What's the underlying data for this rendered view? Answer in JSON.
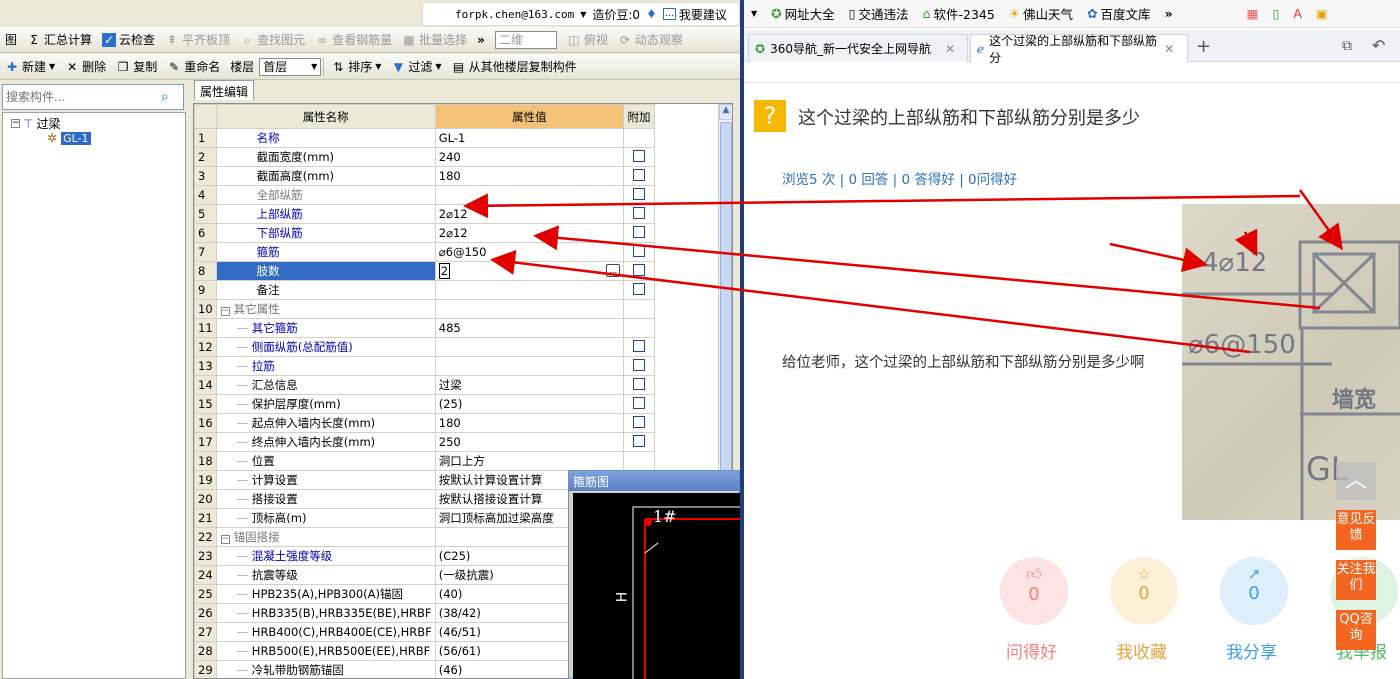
{
  "toolbar1": {
    "items": [
      {
        "label": "图"
      },
      {
        "label": "汇总计算"
      },
      {
        "label": "云检查"
      },
      {
        "label": "平齐板顶"
      },
      {
        "label": "查找图元"
      },
      {
        "label": "查看钢筋量"
      },
      {
        "label": "批量选择"
      },
      {
        "label": "二维"
      },
      {
        "label": "俯视"
      },
      {
        "label": "动态观察"
      }
    ]
  },
  "toolbar2": {
    "new": "新建",
    "delete": "删除",
    "copy": "复制",
    "rename": "重命名",
    "floor_label": "楼层",
    "floor_value": "首层",
    "sort": "排序",
    "filter": "过滤",
    "copy_from": "从其他楼层复制构件"
  },
  "search": {
    "placeholder": "搜索构件..."
  },
  "tree": {
    "root": "过梁",
    "child": "GL-1"
  },
  "prop_tab": "属性编辑",
  "grid": {
    "headers": {
      "name": "属性名称",
      "value": "属性值",
      "extra": "附加"
    },
    "rows": [
      {
        "n": "1",
        "name": "名称",
        "value": "GL-1",
        "style": "blue",
        "cb": false
      },
      {
        "n": "2",
        "name": "截面宽度(mm)",
        "value": "240",
        "style": "",
        "cb": true
      },
      {
        "n": "3",
        "name": "截面高度(mm)",
        "value": "180",
        "style": "",
        "cb": true
      },
      {
        "n": "4",
        "name": "全部纵筋",
        "value": "",
        "style": "grey",
        "cb": true
      },
      {
        "n": "5",
        "name": "上部纵筋",
        "value": "2⌀12",
        "style": "blue",
        "cb": true
      },
      {
        "n": "6",
        "name": "下部纵筋",
        "value": "2⌀12",
        "style": "blue",
        "cb": true
      },
      {
        "n": "7",
        "name": "箍筋",
        "value": "⌀6@150",
        "style": "blue",
        "cb": true
      },
      {
        "n": "8",
        "name": "肢数",
        "value": "2",
        "style": "sel",
        "cb": true
      },
      {
        "n": "9",
        "name": "备注",
        "value": "",
        "style": "",
        "cb": true
      },
      {
        "n": "10",
        "name": "其它属性",
        "value": "",
        "style": "group",
        "cb": false
      },
      {
        "n": "11",
        "name": "其它箍筋",
        "value": "485",
        "style": "blue",
        "cb": false
      },
      {
        "n": "12",
        "name": "侧面纵筋(总配筋值)",
        "value": "",
        "style": "blue",
        "cb": true
      },
      {
        "n": "13",
        "name": "拉筋",
        "value": "",
        "style": "blue",
        "cb": true
      },
      {
        "n": "14",
        "name": "汇总信息",
        "value": "过梁",
        "style": "",
        "cb": true
      },
      {
        "n": "15",
        "name": "保护层厚度(mm)",
        "value": "(25)",
        "style": "",
        "cb": true
      },
      {
        "n": "16",
        "name": "起点伸入墙内长度(mm)",
        "value": "180",
        "style": "",
        "cb": true
      },
      {
        "n": "17",
        "name": "终点伸入墙内长度(mm)",
        "value": "250",
        "style": "",
        "cb": true
      },
      {
        "n": "18",
        "name": "位置",
        "value": "洞口上方",
        "style": "",
        "cb": false
      },
      {
        "n": "19",
        "name": "计算设置",
        "value": "按默认计算设置计算",
        "style": "",
        "cb": false
      },
      {
        "n": "20",
        "name": "搭接设置",
        "value": "按默认搭接设置计算",
        "style": "",
        "cb": false
      },
      {
        "n": "21",
        "name": "顶标高(m)",
        "value": "洞口顶标高加过梁高度",
        "style": "",
        "cb": false
      },
      {
        "n": "22",
        "name": "锚固搭接",
        "value": "",
        "style": "group",
        "cb": false
      },
      {
        "n": "23",
        "name": "混凝土强度等级",
        "value": "(C25)",
        "style": "blue",
        "cb": false
      },
      {
        "n": "24",
        "name": "抗震等级",
        "value": "(一级抗震)",
        "style": "",
        "cb": false
      },
      {
        "n": "25",
        "name": "HPB235(A),HPB300(A)锚固",
        "value": "(40)",
        "style": "",
        "cb": false
      },
      {
        "n": "26",
        "name": "HRB335(B),HRB335E(BE),HRBF",
        "value": "(38/42)",
        "style": "",
        "cb": false
      },
      {
        "n": "27",
        "name": "HRB400(C),HRB400E(CE),HRBF",
        "value": "(46/51)",
        "style": "",
        "cb": false
      },
      {
        "n": "28",
        "name": "HRB500(E),HRB500E(EE),HRBF",
        "value": "(56/61)",
        "style": "",
        "cb": false
      },
      {
        "n": "29",
        "name": "冷轧带肋钢筋锚固",
        "value": "(46)",
        "style": "",
        "cb": false
      }
    ]
  },
  "stirrup": {
    "title": "箍筋图",
    "label_1": "1#",
    "label_h": "H"
  },
  "topbar": {
    "email": "forpk.chen@163.com",
    "balance": "造价豆:0",
    "suggest": "我要建议"
  },
  "bookmarks": [
    "网址大全",
    "交通违法",
    "软件-2345",
    "佛山天气",
    "百度文库"
  ],
  "tabs": [
    {
      "label": "360导航_新一代安全上网导航"
    },
    {
      "label": "这个过梁的上部纵筋和下部纵筋分"
    }
  ],
  "question": {
    "title": "这个过梁的上部纵筋和下部纵筋分别是多少",
    "stats": "浏览5 次 | 0 回答 | 0 答得好 | 0问得好",
    "body": "给位老师，这个过梁的上部纵筋和下部纵筋分别是多少啊"
  },
  "photo": {
    "top_label": "4⌀12",
    "bottom_label": "⌀6@150",
    "wall_label": "墙宽",
    "gl_label": "GL"
  },
  "actions": [
    {
      "count": "0",
      "label": "问得好",
      "color": "#f47f7f",
      "bg": "#fde3e3"
    },
    {
      "count": "0",
      "label": "我收藏",
      "color": "#e8a23c",
      "bg": "#fdf0d9"
    },
    {
      "count": "0",
      "label": "我分享",
      "color": "#3da0e4",
      "bg": "#ddeffb"
    },
    {
      "count": "",
      "label": "我举报",
      "color": "#56b86a",
      "bg": "#dff3e3"
    }
  ],
  "side": {
    "feedback": "意见反馈",
    "follow": "关注我们",
    "qq": "QQ咨询"
  }
}
